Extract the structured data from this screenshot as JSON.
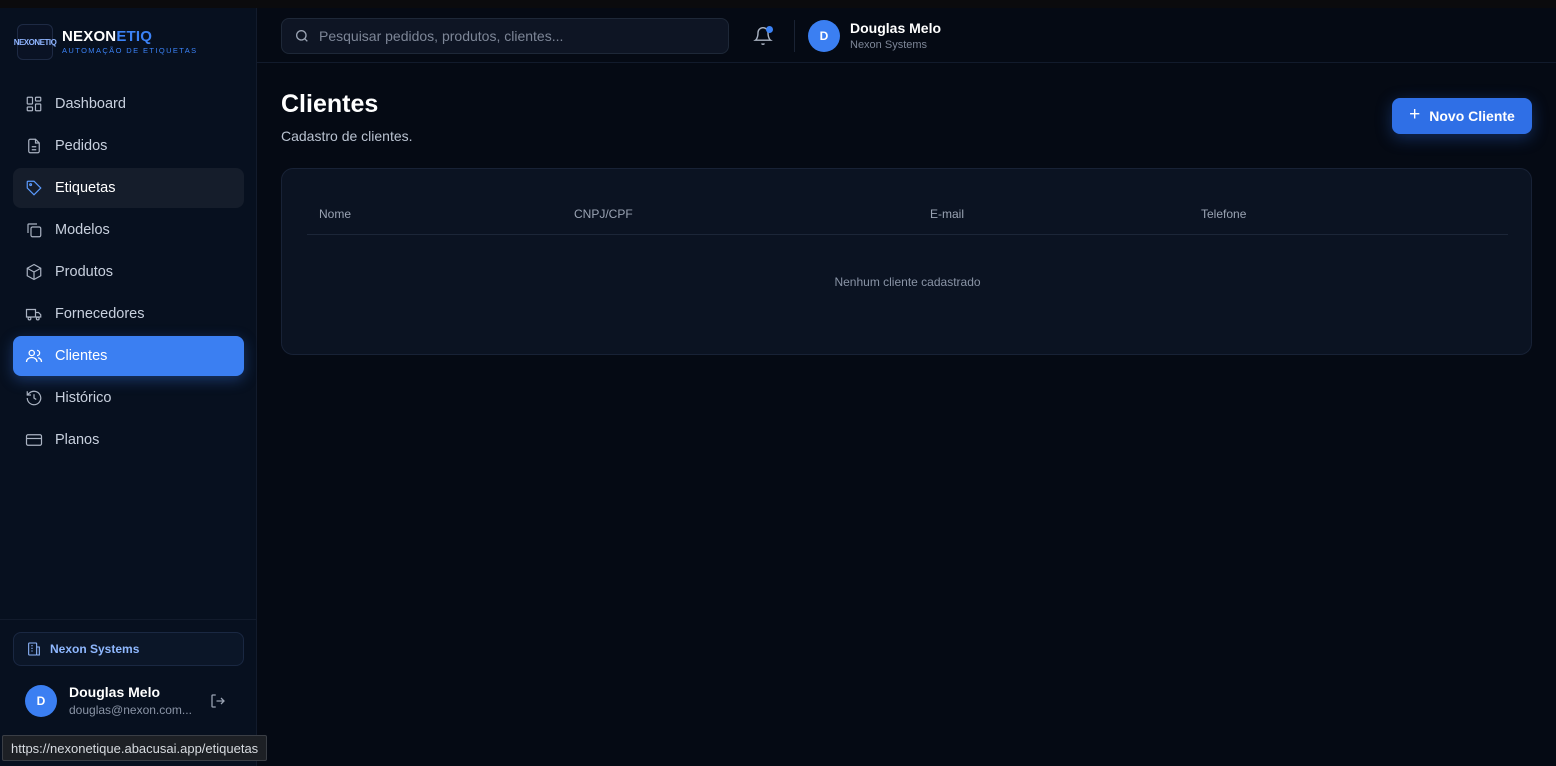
{
  "brand": {
    "name_main": "NEXON",
    "name_accent": "ETIQ",
    "tagline": "AUTOMAÇÃO DE ETIQUETAS",
    "logo_text": "NEXONETIQ"
  },
  "sidebar": {
    "items": [
      {
        "label": "Dashboard",
        "icon": "dashboard-icon"
      },
      {
        "label": "Pedidos",
        "icon": "document-icon"
      },
      {
        "label": "Etiquetas",
        "icon": "tag-icon"
      },
      {
        "label": "Modelos",
        "icon": "copy-icon"
      },
      {
        "label": "Produtos",
        "icon": "box-icon"
      },
      {
        "label": "Fornecedores",
        "icon": "truck-icon"
      },
      {
        "label": "Clientes",
        "icon": "users-icon"
      },
      {
        "label": "Histórico",
        "icon": "history-icon"
      },
      {
        "label": "Planos",
        "icon": "credit-card-icon"
      }
    ],
    "active_item": "Clientes",
    "hover_item": "Etiquetas",
    "organization": "Nexon Systems",
    "user": {
      "initial": "D",
      "name": "Douglas Melo",
      "email": "douglas@nexon.com..."
    }
  },
  "topbar": {
    "search_placeholder": "Pesquisar pedidos, produtos, clientes...",
    "user": {
      "initial": "D",
      "name": "Douglas Melo",
      "company": "Nexon Systems"
    }
  },
  "main": {
    "title": "Clientes",
    "subtitle": "Cadastro de clientes.",
    "new_button": "Novo Cliente",
    "table": {
      "columns": [
        "Nome",
        "CNPJ/CPF",
        "E-mail",
        "Telefone"
      ],
      "rows": [],
      "empty_message": "Nenhum cliente cadastrado"
    }
  },
  "statusbar": {
    "url": "https://nexonetique.abacusai.app/etiquetas"
  },
  "colors": {
    "accent": "#3b7ff2",
    "background": "#050a14",
    "sidebar": "#07101f",
    "card": "#0b1322"
  }
}
